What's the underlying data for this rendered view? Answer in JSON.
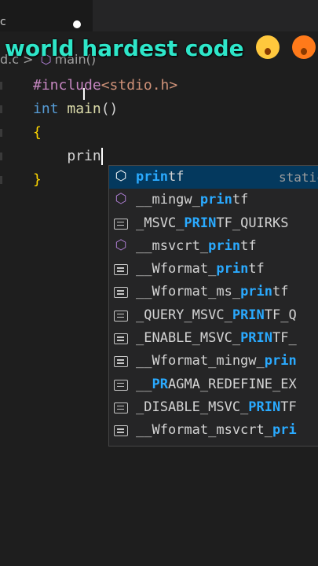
{
  "window": {
    "file_label": "c"
  },
  "caption": {
    "text": "world hardest code"
  },
  "breadcrumb": {
    "file": "d.c",
    "separator": ">",
    "symbol": "main()"
  },
  "editor": {
    "lines": [
      {
        "parts": [
          {
            "t": "#include",
            "c": "pp"
          },
          {
            "t": "<stdio.h>",
            "c": "inc"
          }
        ]
      },
      {
        "parts": [
          {
            "t": "int ",
            "c": "kw"
          },
          {
            "t": "main",
            "c": "fn"
          },
          {
            "t": "()",
            "c": "plain"
          }
        ]
      },
      {
        "parts": [
          {
            "t": "{",
            "c": "brace"
          }
        ]
      },
      {
        "parts": [
          {
            "t": "    prin",
            "c": "plain"
          }
        ]
      },
      {
        "parts": [
          {
            "t": "}",
            "c": "brace"
          }
        ]
      }
    ]
  },
  "suggestions": {
    "selected_detail": "static",
    "items": [
      {
        "icon": "method-icon",
        "pre": "",
        "match": "prin",
        "post": "tf",
        "selected": true
      },
      {
        "icon": "method-icon",
        "pre": "__mingw_",
        "match": "prin",
        "post": "tf"
      },
      {
        "icon": "constant-icon",
        "pre": "_MSVC_",
        "match": "PRIN",
        "post": "TF_QUIRKS"
      },
      {
        "icon": "method-icon",
        "pre": "__msvcrt_",
        "match": "prin",
        "post": "tf"
      },
      {
        "icon": "constant-icon",
        "pre": "__Wformat_",
        "match": "prin",
        "post": "tf"
      },
      {
        "icon": "constant-icon",
        "pre": "__Wformat_ms_",
        "match": "prin",
        "post": "tf"
      },
      {
        "icon": "constant-icon",
        "pre": "_QUERY_MSVC_",
        "match": "PRIN",
        "post": "TF_Q"
      },
      {
        "icon": "constant-icon",
        "pre": "_ENABLE_MSVC_",
        "match": "PRIN",
        "post": "TF_"
      },
      {
        "icon": "constant-icon",
        "pre": "__Wformat_mingw_",
        "match": "prin",
        "post": ""
      },
      {
        "icon": "constant-icon",
        "pre": "__",
        "match": "PR",
        "post": "AGMA_REDEFINE_EX"
      },
      {
        "icon": "constant-icon",
        "pre": "_DISABLE_MSVC_",
        "match": "PRIN",
        "post": "TF"
      },
      {
        "icon": "constant-icon",
        "pre": "__Wformat_msvcrt_",
        "match": "pri",
        "post": ""
      }
    ]
  },
  "colors": {
    "caption": "#2ee6c9",
    "match_highlight": "#2aaaff",
    "selection": "#04395e"
  }
}
